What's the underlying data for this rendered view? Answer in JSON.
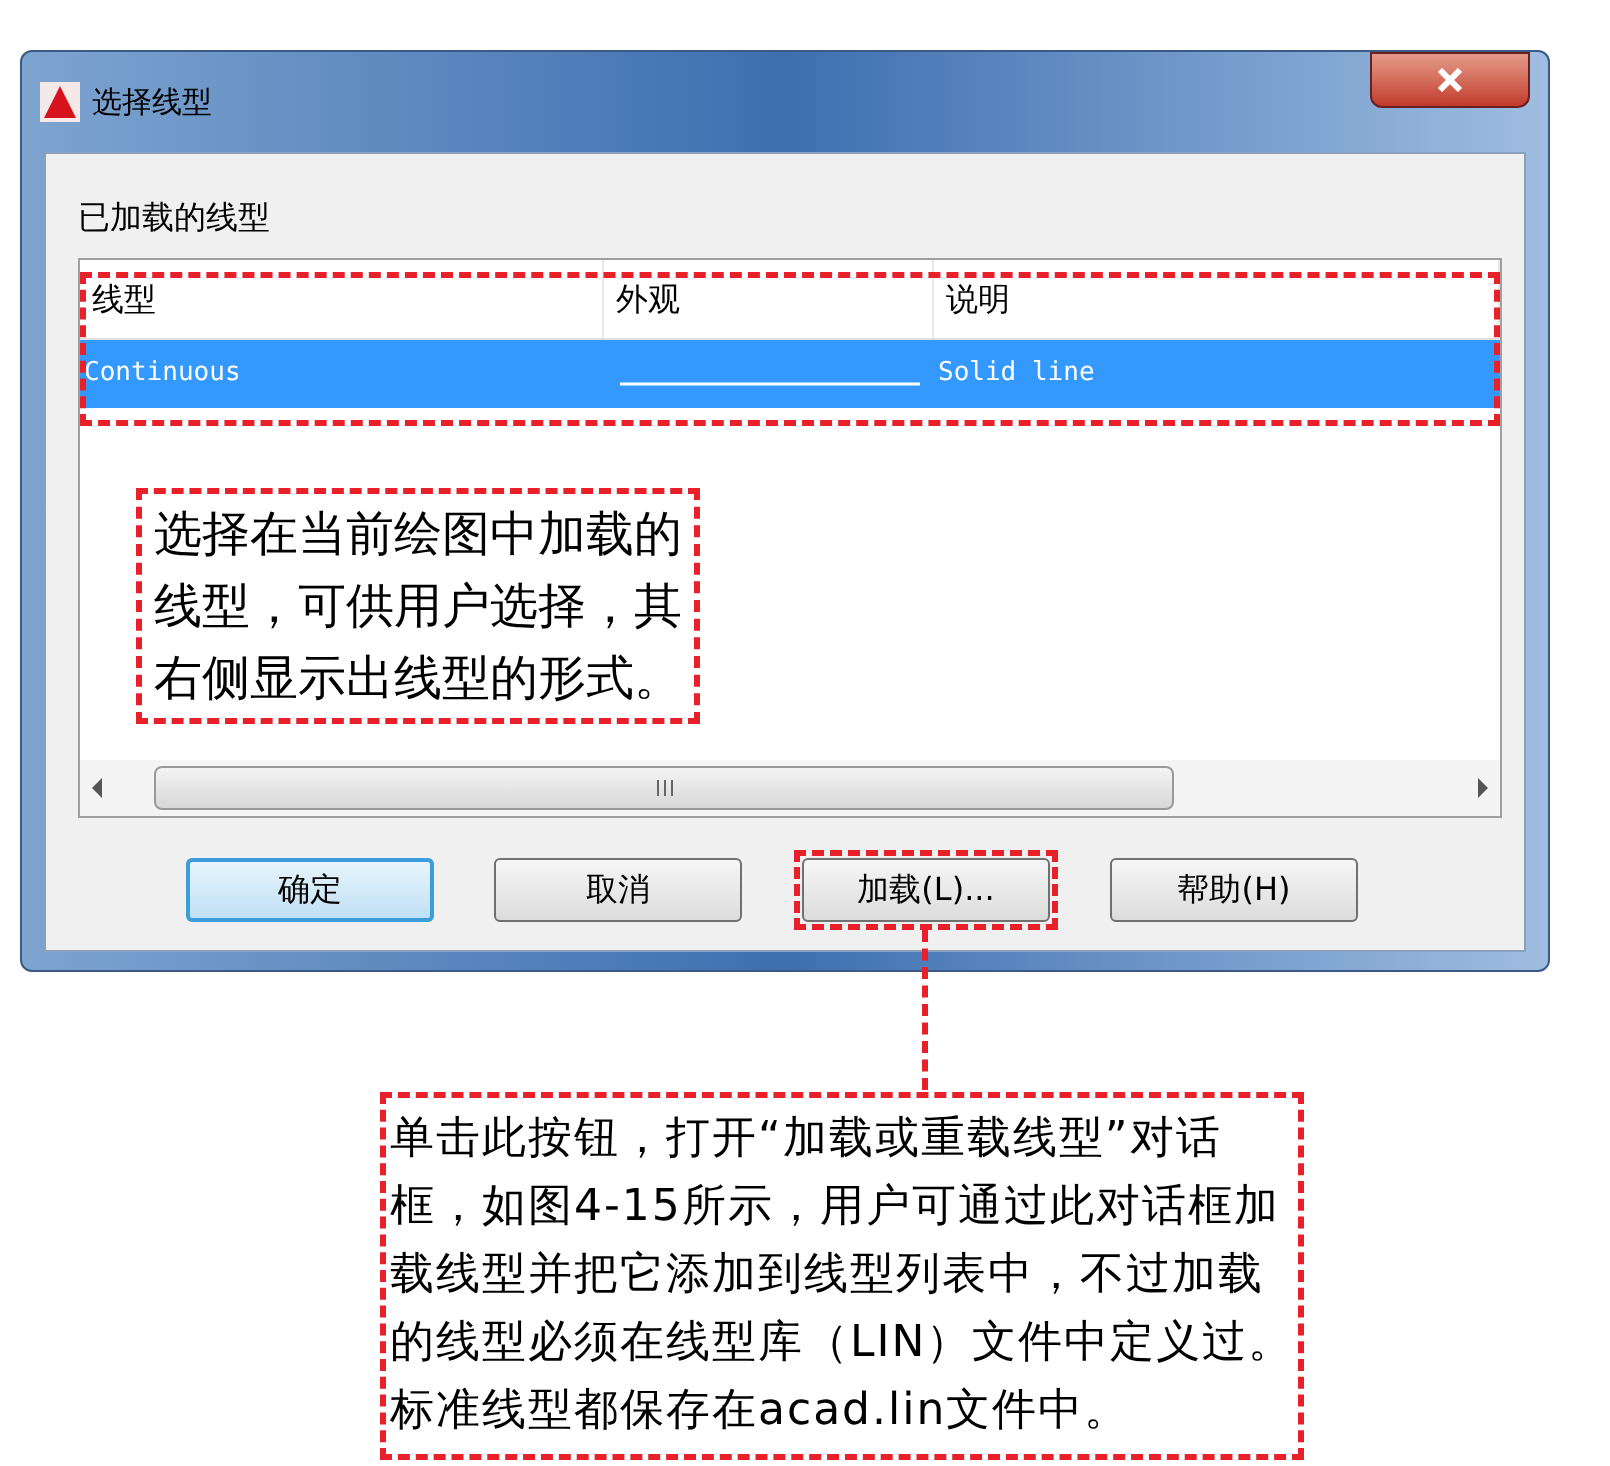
{
  "window": {
    "title": "选择线型"
  },
  "group_label": "已加载的线型",
  "table": {
    "columns": [
      "线型",
      "外观",
      "说明"
    ],
    "rows": [
      {
        "linetype": "Continuous",
        "description": "Solid line",
        "selected": true
      }
    ],
    "annotated": true
  },
  "list_note": {
    "lines": [
      "选择在当前绘图中加载的",
      "线型，可供用户选择，其",
      "右侧显示出线型的形式。"
    ]
  },
  "buttons": [
    {
      "label": "确定",
      "default": true,
      "annotated": false
    },
    {
      "label": "取消",
      "default": false,
      "annotated": false
    },
    {
      "label": "加载(L)...",
      "default": false,
      "annotated": true
    },
    {
      "label": "帮助(H)",
      "default": false,
      "annotated": false
    }
  ],
  "callout": {
    "lines": [
      "单击此按钮，打开“加载或重载线型”对话",
      "框，如图4-15所示，用户可通过此对话框加",
      "载线型并把它添加到线型列表中，不过加载",
      "的线型必须在线型库（LIN）文件中定义过。",
      "标准线型都保存在acad.lin文件中。"
    ]
  }
}
